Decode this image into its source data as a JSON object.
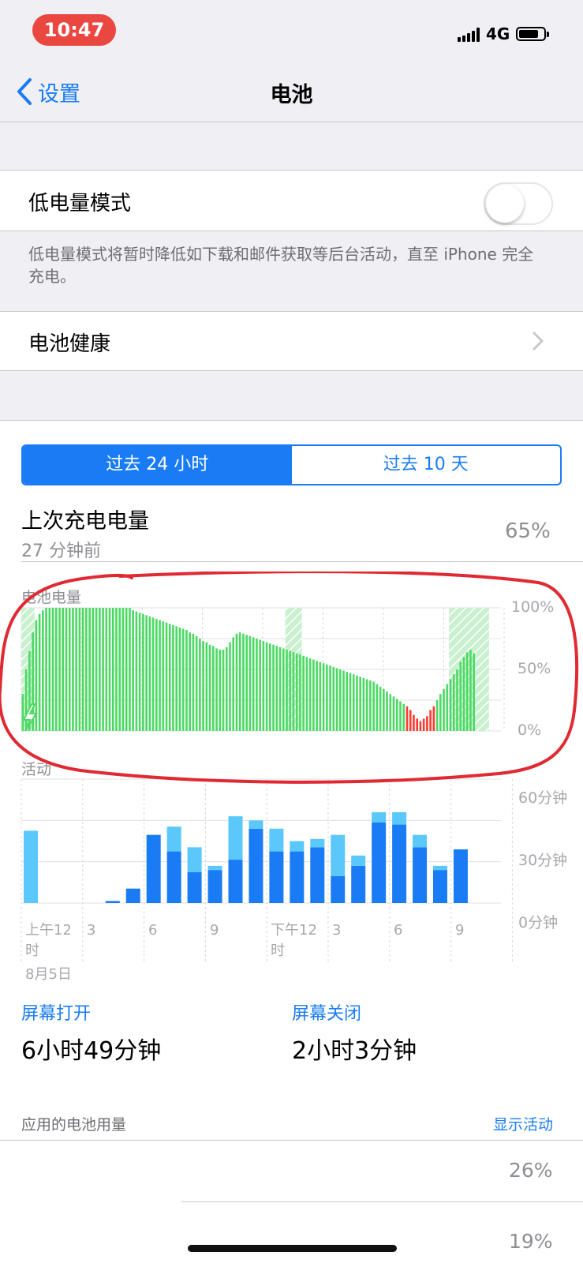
{
  "status_bar": {
    "time": "10:47",
    "network": "4G",
    "battery_level": 0.8
  },
  "nav": {
    "back_label": "设置",
    "title": "电池"
  },
  "low_power": {
    "label": "低电量模式",
    "enabled": false,
    "note": "低电量模式将暂时降低如下载和邮件获取等后台活动，直至 iPhone 完全充电。"
  },
  "battery_health": {
    "label": "电池健康"
  },
  "tabs": [
    {
      "label": "过去 24 小时",
      "active": true
    },
    {
      "label": "过去 10 天",
      "active": false
    }
  ],
  "last_charge": {
    "label": "上次充电电量",
    "time": "27 分钟前",
    "value": "65%"
  },
  "battery_chart": {
    "label": "电池电量",
    "y_labels": [
      "100%",
      "50%",
      "0%"
    ],
    "colors": {
      "normal": "#4cd964",
      "low": "#ff3b30",
      "charging_shade": "#c9f0cf"
    }
  },
  "activity_chart": {
    "label": "活动",
    "y_labels": [
      "60分钟",
      "30分钟",
      "0分钟"
    ],
    "x_labels": [
      "上午12时",
      "3",
      "6",
      "9",
      "下午12时",
      "3",
      "6",
      "9"
    ],
    "date_label": "8月5日",
    "colors": {
      "screen_on": "#1a7cf4",
      "screen_off": "#5ac8fa"
    }
  },
  "chart_data": [
    {
      "type": "bar",
      "title": "电池电量",
      "ylim": [
        0,
        100
      ],
      "values": [
        30,
        50,
        65,
        80,
        90,
        95,
        98,
        100,
        100,
        100,
        100,
        100,
        100,
        100,
        100,
        100,
        100,
        100,
        100,
        100,
        100,
        100,
        100,
        100,
        100,
        100,
        100,
        100,
        100,
        100,
        100,
        100,
        100,
        98,
        97,
        96,
        95,
        94,
        93,
        92,
        91,
        90,
        89,
        88,
        87,
        86,
        85,
        84,
        83,
        82,
        80,
        79,
        77,
        75,
        73,
        72,
        70,
        69,
        67,
        66,
        66,
        68,
        72,
        76,
        79,
        80,
        79,
        78,
        77,
        76,
        75,
        74,
        73,
        72,
        71,
        70,
        69,
        68,
        67,
        66,
        65,
        64,
        63,
        62,
        61,
        60,
        59,
        58,
        57,
        56,
        55,
        54,
        53,
        52,
        51,
        50,
        49,
        48,
        47,
        46,
        45,
        44,
        43,
        42,
        41,
        40,
        38,
        36,
        34,
        32,
        30,
        28,
        26,
        24,
        22,
        20,
        17,
        13,
        10,
        8,
        10,
        12,
        17,
        20,
        25,
        30,
        34,
        38,
        42,
        46,
        50,
        56,
        60,
        64,
        66,
        63
      ],
      "low_color_threshold": 20,
      "charging_intervals": [
        [
          0,
          4
        ],
        [
          79,
          84
        ],
        [
          128,
          140
        ]
      ]
    },
    {
      "type": "bar",
      "title": "活动",
      "categories": [
        "0",
        "1",
        "2",
        "3",
        "4",
        "5",
        "6",
        "7",
        "8",
        "9",
        "10",
        "11",
        "12",
        "13",
        "14",
        "15",
        "16",
        "17",
        "18",
        "19",
        "20",
        "21",
        "22",
        "23"
      ],
      "ylim": [
        0,
        60
      ],
      "series": [
        {
          "name": "屏幕打开",
          "values": [
            0,
            0,
            0,
            0,
            1,
            7,
            33,
            25,
            15,
            16,
            21,
            36,
            25,
            25,
            27,
            13,
            18,
            39,
            38,
            27,
            16,
            26,
            0,
            0
          ]
        },
        {
          "name": "屏幕关闭",
          "values": [
            35,
            0,
            0,
            0,
            0,
            0,
            0,
            12,
            12,
            2,
            21,
            4,
            11,
            5,
            4,
            20,
            5,
            5,
            6,
            6,
            2,
            0,
            0,
            0
          ]
        }
      ]
    }
  ],
  "stats": [
    {
      "label": "屏幕打开",
      "value": "6小时49分钟"
    },
    {
      "label": "屏幕关闭",
      "value": "2小时3分钟"
    }
  ],
  "usage": {
    "label": "应用的电池用量",
    "action": "显示活动",
    "rows": [
      {
        "value": "26%"
      },
      {
        "value": "19%"
      }
    ]
  }
}
